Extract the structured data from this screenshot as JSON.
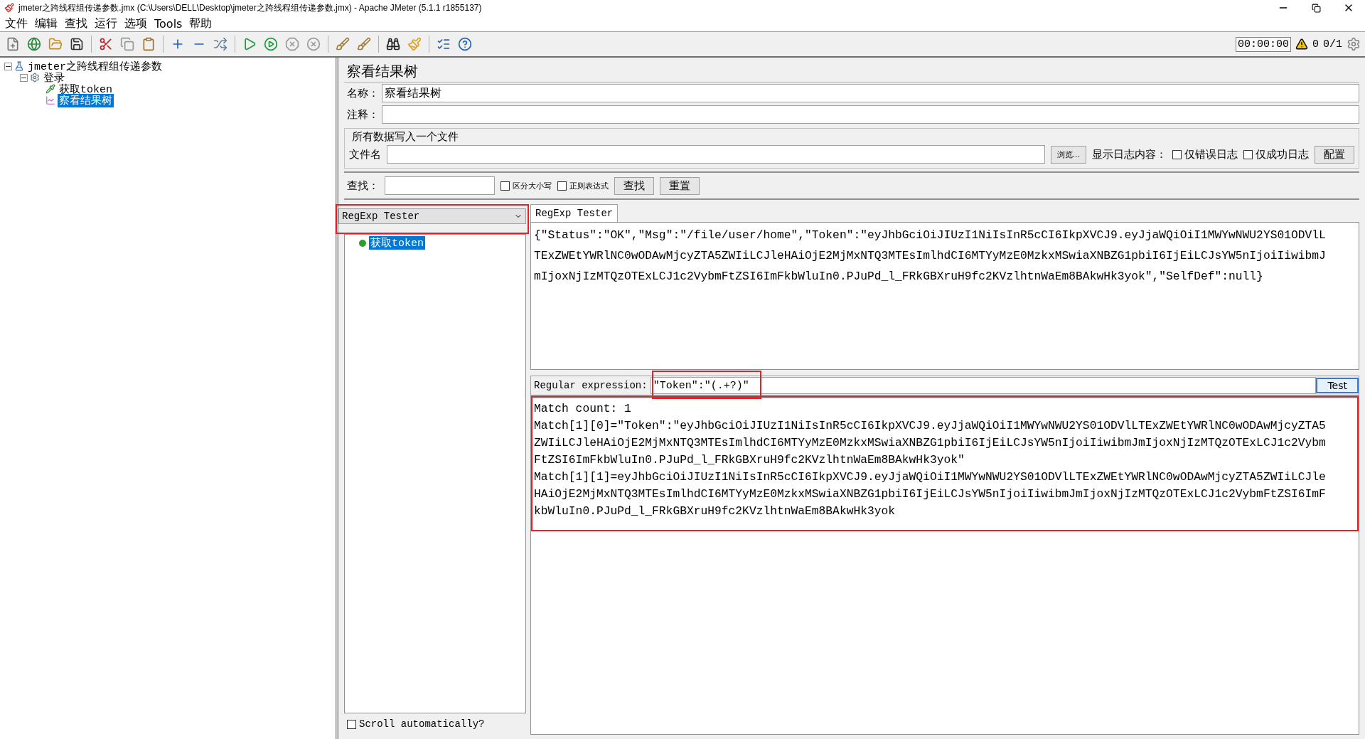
{
  "window": {
    "title": "jmeter之跨线程组传递参数.jmx (C:\\Users\\DELL\\Desktop\\jmeter之跨线程组传递参数.jmx) - Apache JMeter (5.1.1 r1855137)"
  },
  "menu": [
    "文件",
    "编辑",
    "查找",
    "运行",
    "选项",
    "Tools",
    "帮助"
  ],
  "toolbar": {
    "timer": "00:00:00",
    "warnings": "0",
    "threads": "0/1"
  },
  "tree": [
    {
      "label": "jmeter之跨线程组传递参数",
      "kind": "plan",
      "expanded": true,
      "selected": false,
      "children": [
        {
          "label": "登录",
          "kind": "group",
          "expanded": true,
          "selected": false,
          "children": [
            {
              "label": "获取token",
              "kind": "sampler",
              "selected": false
            },
            {
              "label": "察看结果树",
              "kind": "listener",
              "selected": true
            }
          ]
        }
      ]
    }
  ],
  "panel": {
    "title": "察看结果树",
    "name_label": "名称：",
    "name_value": "察看结果树",
    "comment_label": "注释："
  },
  "file_group": {
    "title": "所有数据写入一个文件",
    "label": "文件名",
    "browse": "浏览...",
    "log_label": "显示日志内容：",
    "options": [
      {
        "label": "仅错误日志",
        "checked": false
      },
      {
        "label": "仅成功日志",
        "checked": false
      }
    ],
    "config": "配置"
  },
  "search": {
    "label": "查找：",
    "options": [
      {
        "label": "区分大小写",
        "checked": false
      },
      {
        "label": "正则表达式",
        "checked": false
      }
    ],
    "buttons": [
      "查找",
      "重置"
    ]
  },
  "renderer": "RegExp Tester",
  "results": [
    {
      "label": "获取token",
      "selected": true
    }
  ],
  "scroll_auto": {
    "label": "Scroll automatically?",
    "checked": false
  },
  "tabs": [
    {
      "label": "RegExp Tester",
      "selected": true
    }
  ],
  "response_lines": [
    "{\"Status\":\"OK\",\"Msg\":\"/file/user/home\",\"Token\":\"eyJhbGciOiJIUzI1NiIsInR5cCI6IkpXVCJ9.eyJjaWQiOiI1MWYwNWU2YS01ODVlL",
    "TExZWEtYWRlNC0wODAwMjcyZTA5ZWIiLCJleHAiOjE2MjMxNTQ3MTEsImlhdCI6MTYyMzE0MzkxMSwiaXNBZG1pbiI6IjEiLCJsYW5nIjoiIiwibmJ",
    "mIjoxNjIzMTQzOTExLCJ1c2VybmFtZSI6ImFkbWluIn0.PJuPd_l_FRkGBXruH9fc2KVzlhtnWaEm8BAkwHk3yok\",\"SelfDef\":null}"
  ],
  "regex": {
    "label": "Regular expression:",
    "value": "\"Token\":\"(.+?)\"",
    "button": "Test"
  },
  "match_lines": [
    "Match count: 1",
    "Match[1][0]=\"Token\":\"eyJhbGciOiJIUzI1NiIsInR5cCI6IkpXVCJ9.eyJjaWQiOiI1MWYwNWU2YS01ODVlLTExZWEtYWRlNC0wODAwMjcyZTA5",
    "ZWIiLCJleHAiOjE2MjMxNTQ3MTEsImlhdCI6MTYyMzE0MzkxMSwiaXNBZG1pbiI6IjEiLCJsYW5nIjoiIiwibmJmIjoxNjIzMTQzOTExLCJ1c2Vybm",
    "FtZSI6ImFkbWluIn0.PJuPd_l_FRkGBXruH9fc2KVzlhtnWaEm8BAkwHk3yok\"",
    "Match[1][1]=eyJhbGciOiJIUzI1NiIsInR5cCI6IkpXVCJ9.eyJjaWQiOiI1MWYwNWU2YS01ODVlLTExZWEtYWRlNC0wODAwMjcyZTA5ZWIiLCJle",
    "HAiOjE2MjMxNTQ3MTEsImlhdCI6MTYyMzE0MzkxMSwiaXNBZG1pbiI6IjEiLCJsYW5nIjoiIiwibmJmIjoxNjIzMTQzOTExLCJ1c2VybmFtZSI6ImF",
    "kbWluIn0.PJuPd_l_FRkGBXruH9fc2KVzlhtnWaEm8BAkwHk3yok"
  ]
}
